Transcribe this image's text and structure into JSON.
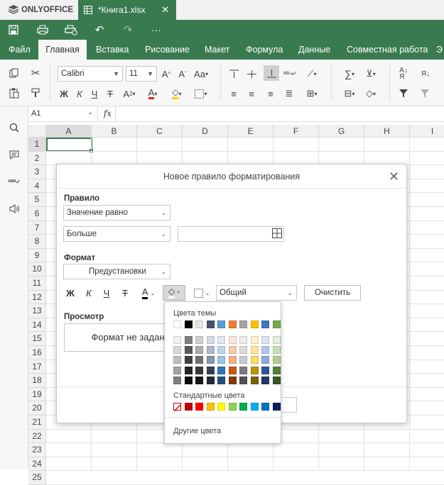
{
  "app": {
    "brand": "ONLYOFFICE",
    "doc_tab": "*Книга1.xlsx"
  },
  "menu": [
    "Файл",
    "Главная",
    "Вставка",
    "Рисование",
    "Макет",
    "Формула",
    "Данные",
    "Совместная работа",
    "Э"
  ],
  "toolbar": {
    "font_name": "Calibri",
    "font_size": "11"
  },
  "formula_bar": {
    "cell_ref": "A1",
    "fx": "fx"
  },
  "grid": {
    "columns": [
      "A",
      "B",
      "C",
      "D",
      "E",
      "F",
      "G",
      "H",
      "I"
    ],
    "rows": [
      "1",
      "2",
      "3",
      "4",
      "5",
      "6",
      "7",
      "8",
      "9",
      "10",
      "11",
      "12",
      "13",
      "14",
      "15",
      "16",
      "17",
      "18",
      "19",
      "20",
      "21",
      "22",
      "23",
      "24",
      "25"
    ]
  },
  "dialog": {
    "title": "Новое правило форматирования",
    "rule_label": "Правило",
    "rule_value": "Значение равно",
    "condition_value": "Больше",
    "format_label": "Формат",
    "presets_value": "Предустановки",
    "number_format": "Общий",
    "clear_button": "Очистить",
    "preview_label": "Просмотр",
    "preview_text": "Формат не задан",
    "bold_glyph": "Ж",
    "italic_glyph": "К",
    "underline_glyph": "Ч"
  },
  "palette": {
    "theme_label": "Цвета темы",
    "standard_label": "Стандартные цвета",
    "more_colors": "Другие цвета",
    "theme_top": [
      "#ffffff",
      "#000000",
      "#e7e6e6",
      "#44546a",
      "#5b9bd5",
      "#ed7d31",
      "#a5a5a5",
      "#ffc000",
      "#4472c4",
      "#70ad47"
    ],
    "theme_shades": [
      [
        "#f2f2f2",
        "#7f7f7f",
        "#d0cece",
        "#d6dce4",
        "#deebf6",
        "#fbe5d6",
        "#ededed",
        "#fff2cc",
        "#dae3f3",
        "#e2efd9"
      ],
      [
        "#d8d8d8",
        "#595959",
        "#aeabab",
        "#adb9ca",
        "#bdd7ee",
        "#f8cbad",
        "#dbdbdb",
        "#fee599",
        "#b4c6e7",
        "#c5e0b3"
      ],
      [
        "#bfbfbf",
        "#3f3f3f",
        "#757070",
        "#8496b0",
        "#9dc3e6",
        "#f4b183",
        "#c9c9c9",
        "#ffd966",
        "#8faadc",
        "#a9d18e"
      ],
      [
        "#a5a5a5",
        "#262626",
        "#3a3838",
        "#333f4f",
        "#2e75b5",
        "#c55a11",
        "#7b7b7b",
        "#bf9000",
        "#2f5597",
        "#538135"
      ],
      [
        "#7f7f7f",
        "#0c0c0c",
        "#171616",
        "#222a35",
        "#1e4e79",
        "#843c0b",
        "#525252",
        "#7f6000",
        "#203864",
        "#375623"
      ]
    ],
    "standard": [
      "none",
      "#c00000",
      "#ff0000",
      "#ffc000",
      "#ffff00",
      "#92d050",
      "#00b050",
      "#00b0f0",
      "#0070c0",
      "#002060"
    ]
  },
  "colors": {
    "accent": "#3a7a4f"
  }
}
